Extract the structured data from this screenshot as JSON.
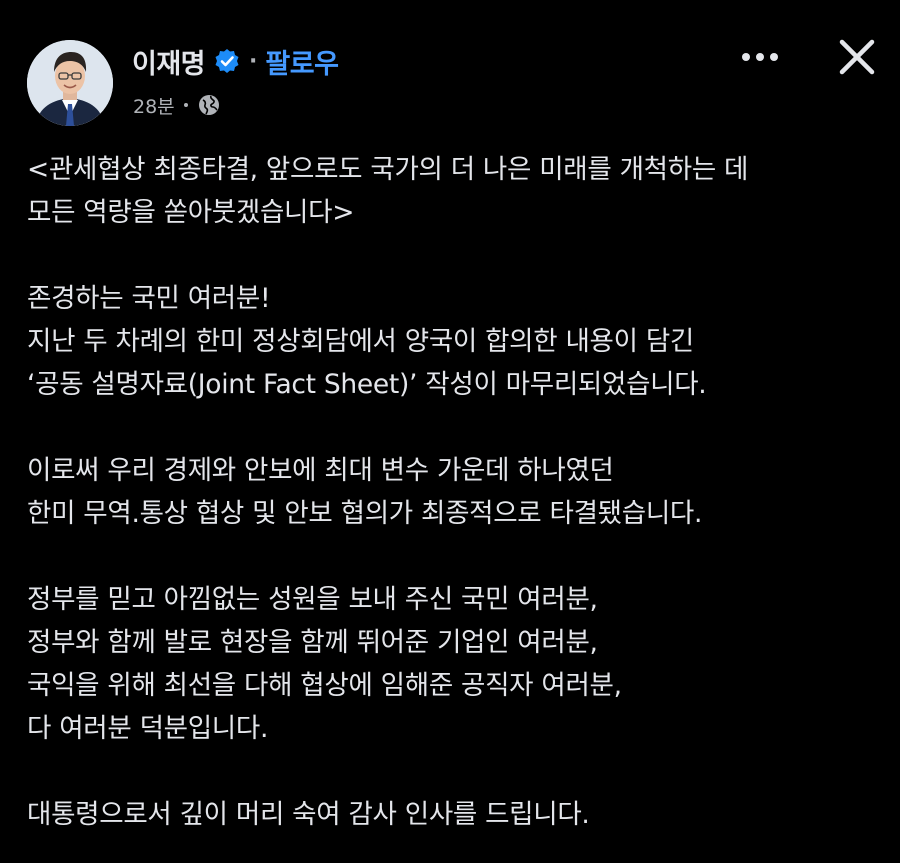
{
  "header": {
    "author_name": "이재명",
    "separator": "·",
    "follow_label": "팔로우",
    "timestamp": "28분",
    "verified_icon": "verified-badge-icon",
    "audience_icon": "globe-icon",
    "more_icon": "more-dots-icon",
    "close_icon": "close-icon"
  },
  "post": {
    "title_line1": "<관세협상 최종타결, 앞으로도 국가의 더 나은 미래를 개척하는 데",
    "title_line2": "모든 역량을 쏟아붓겠습니다>",
    "p1_line1": "존경하는 국민 여러분!",
    "p1_line2": "지난 두 차례의 한미 정상회담에서 양국이 합의한 내용이 담긴",
    "p1_line3": "‘공동 설명자료(Joint Fact Sheet)’ 작성이 마무리되었습니다.",
    "p2_line1": "이로써 우리 경제와 안보에 최대 변수 가운데 하나였던",
    "p2_line2": "한미 무역.통상 협상 및 안보 협의가 최종적으로 타결됐습니다.",
    "p3_line1": "정부를 믿고 아낌없는 성원을 보내 주신 국민 여러분,",
    "p3_line2": "정부와 함께 발로 현장을 함께 뛰어준 기업인 여러분,",
    "p3_line3": "국익을 위해 최선을 다해 협상에 임해준 공직자 여러분,",
    "p3_line4": "다 여러분 덕분입니다.",
    "p4_line1": "대통령으로서 깊이 머리 숙여 감사 인사를 드립니다."
  },
  "colors": {
    "background": "#000000",
    "text": "#e4e6eb",
    "secondary_text": "#b0b3b8",
    "link_blue": "#4599ff",
    "verified_blue": "#1d8cf8"
  }
}
